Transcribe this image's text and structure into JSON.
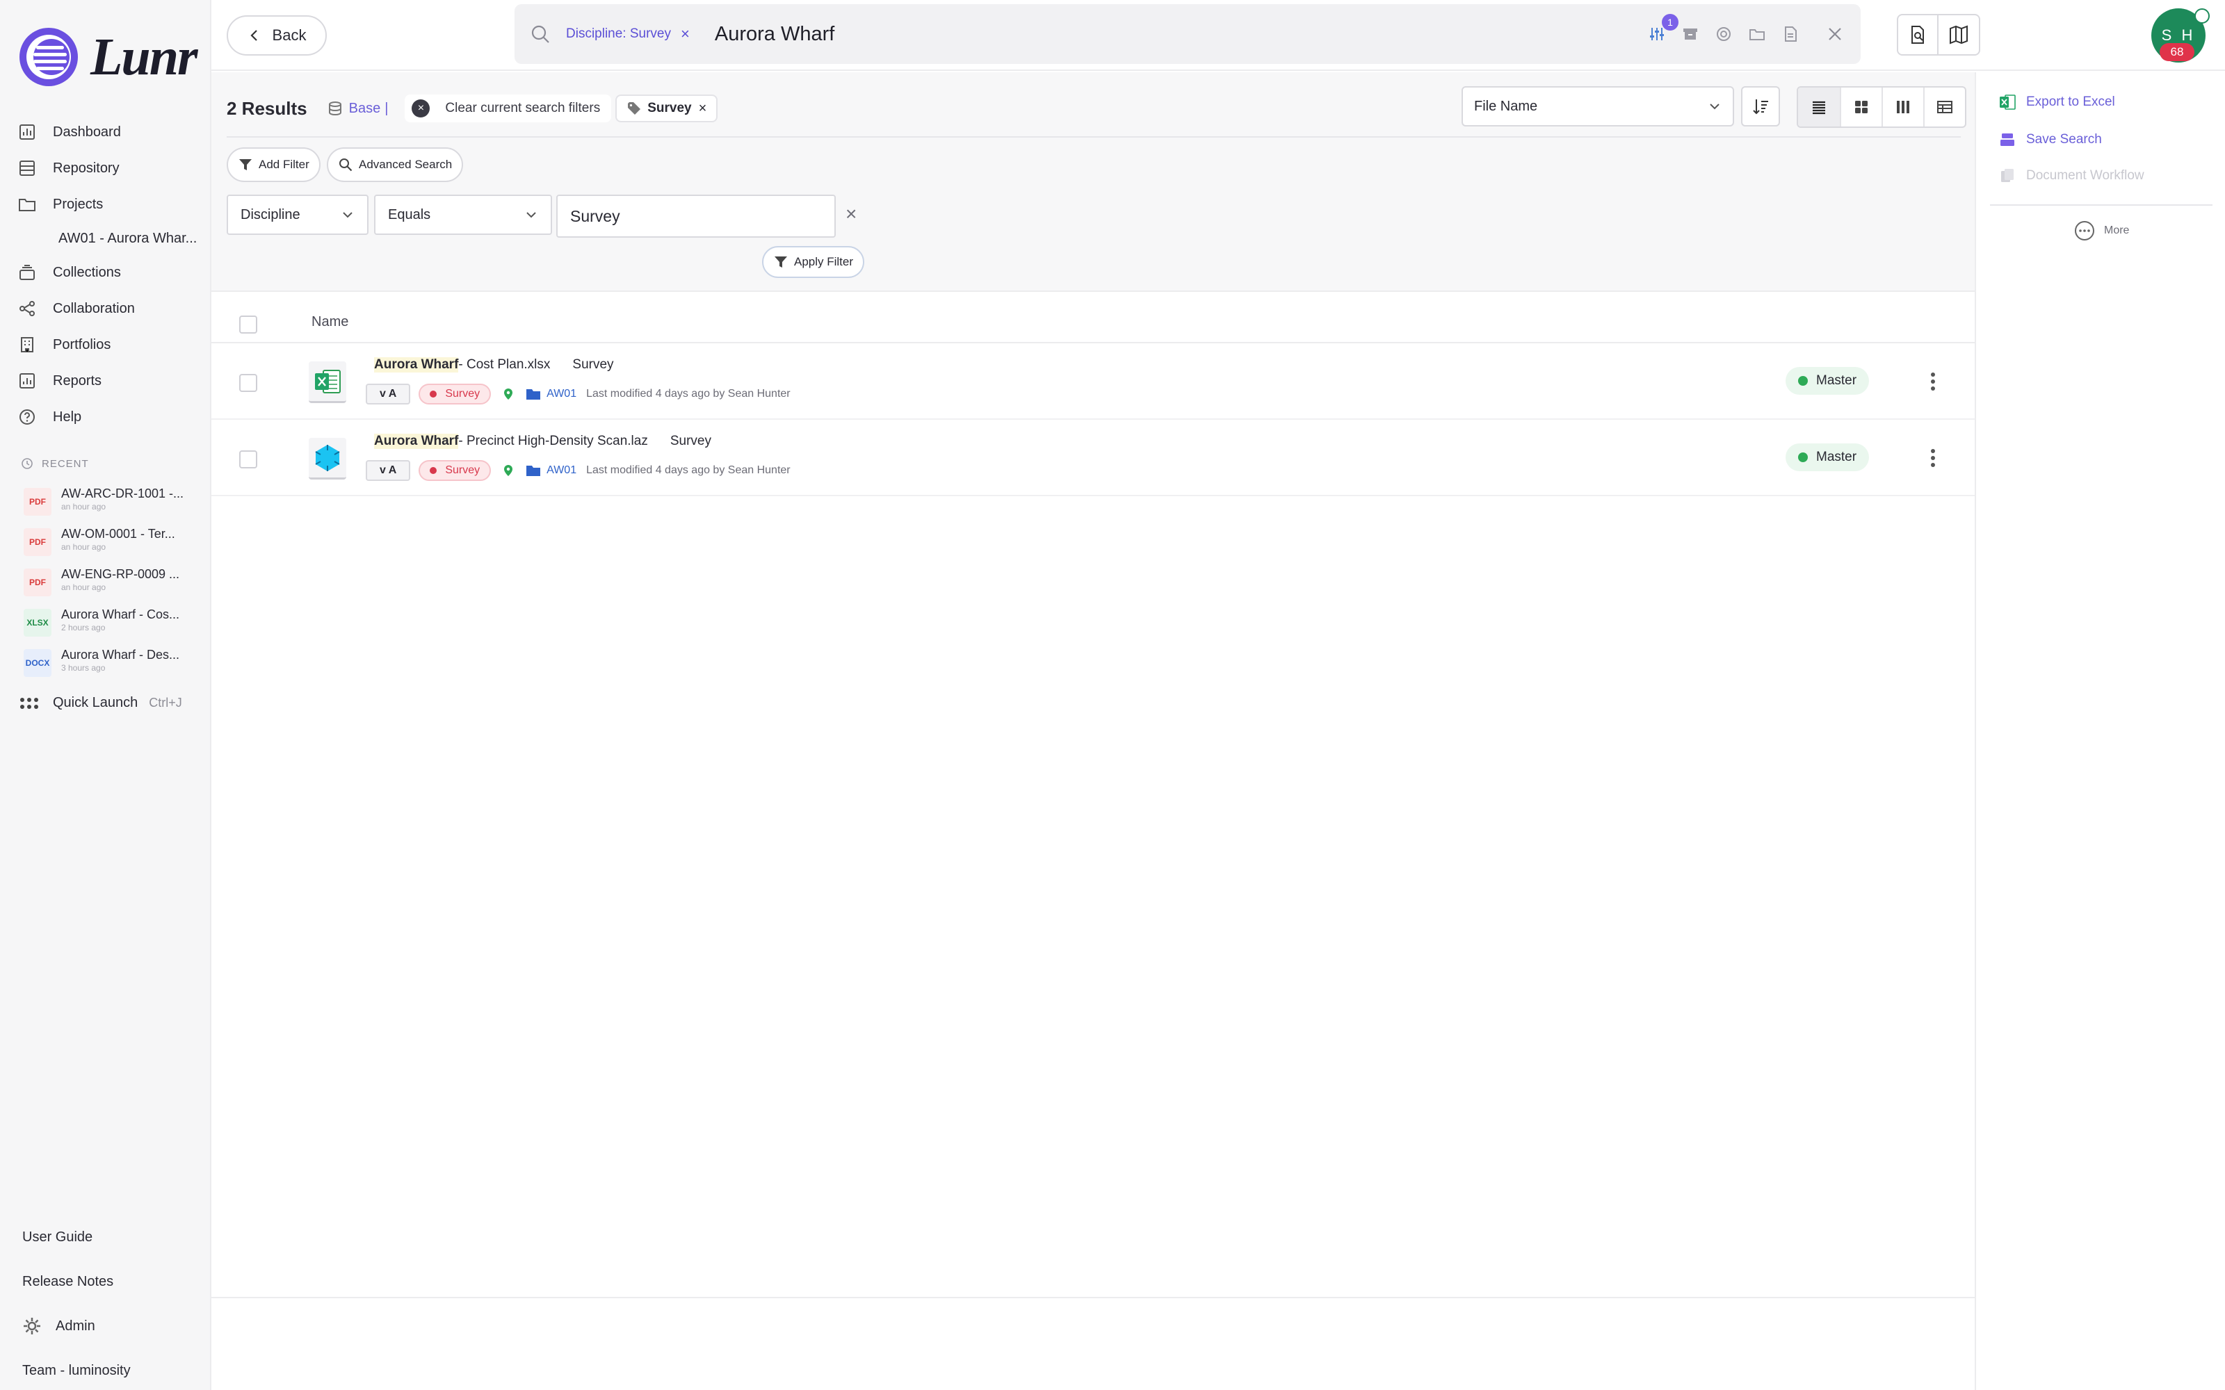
{
  "app": {
    "name": "Lunr"
  },
  "sidebar": {
    "nav": [
      {
        "label": "Dashboard",
        "icon": "dashboard-icon"
      },
      {
        "label": "Repository",
        "icon": "repository-icon"
      },
      {
        "label": "Projects",
        "icon": "folder-icon"
      }
    ],
    "project_sub": "AW01 - Aurora Whar...",
    "nav2": [
      {
        "label": "Collections",
        "icon": "collections-icon"
      },
      {
        "label": "Collaboration",
        "icon": "share-icon"
      },
      {
        "label": "Portfolios",
        "icon": "building-icon"
      },
      {
        "label": "Reports",
        "icon": "reports-icon"
      },
      {
        "label": "Help",
        "icon": "help-icon"
      }
    ],
    "recent_heading": "RECENT",
    "recent": [
      {
        "type": "PDF",
        "title": "AW-ARC-DR-1001 -...",
        "time": "an hour ago"
      },
      {
        "type": "PDF",
        "title": "AW-OM-0001 - Ter...",
        "time": "an hour ago"
      },
      {
        "type": "PDF",
        "title": "AW-ENG-RP-0009 ...",
        "time": "an hour ago"
      },
      {
        "type": "XLSX",
        "title": "Aurora Wharf - Cos...",
        "time": "2 hours ago"
      },
      {
        "type": "DOCX",
        "title": "Aurora Wharf - Des...",
        "time": "3 hours ago"
      }
    ],
    "quick_launch": {
      "label": "Quick Launch",
      "shortcut": "Ctrl+J"
    },
    "bottom": {
      "user_guide": "User Guide",
      "release_notes": "Release Notes",
      "admin": "Admin",
      "team": "Team - luminosity"
    }
  },
  "topbar": {
    "back_label": "Back",
    "search": {
      "filter_chip": "Discipline: Survey",
      "query": "Aurora Wharf",
      "filter_count": "1"
    },
    "avatar": {
      "initials": "S H",
      "badge": "68"
    }
  },
  "results": {
    "count_label": "2 Results",
    "base_label": "Base",
    "separator": "|",
    "clear_label": "Clear current search filters",
    "active_tag": "Survey",
    "sort_field": "File Name"
  },
  "filters": {
    "add_filter": "Add Filter",
    "advanced_search": "Advanced Search",
    "field": "Discipline",
    "operator": "Equals",
    "value": "Survey",
    "apply": "Apply Filter"
  },
  "table": {
    "header_name": "Name",
    "rows": [
      {
        "name_highlight": "Aurora Wharf",
        "name_rest": " - Cost Plan.xlsx",
        "discipline": "Survey",
        "version": "v A",
        "discipline_tag": "Survey",
        "project": "AW01",
        "modified": "Last modified 4 days ago by Sean Hunter",
        "status": "Master",
        "file_icon": "excel-icon"
      },
      {
        "name_highlight": "Aurora Wharf",
        "name_rest": " - Precinct High-Density Scan.laz",
        "discipline": "Survey",
        "version": "v A",
        "discipline_tag": "Survey",
        "project": "AW01",
        "modified": "Last modified 4 days ago by Sean Hunter",
        "status": "Master",
        "file_icon": "pointcloud-icon"
      }
    ]
  },
  "right_panel": {
    "export_excel": "Export to Excel",
    "save_search": "Save Search",
    "document_workflow": "Document Workflow",
    "more": "More"
  },
  "colors": {
    "accent": "#6a5fd8",
    "status_green": "#2eaa56",
    "discipline_red": "#d8384c",
    "avatar": "#1d8a5a"
  }
}
